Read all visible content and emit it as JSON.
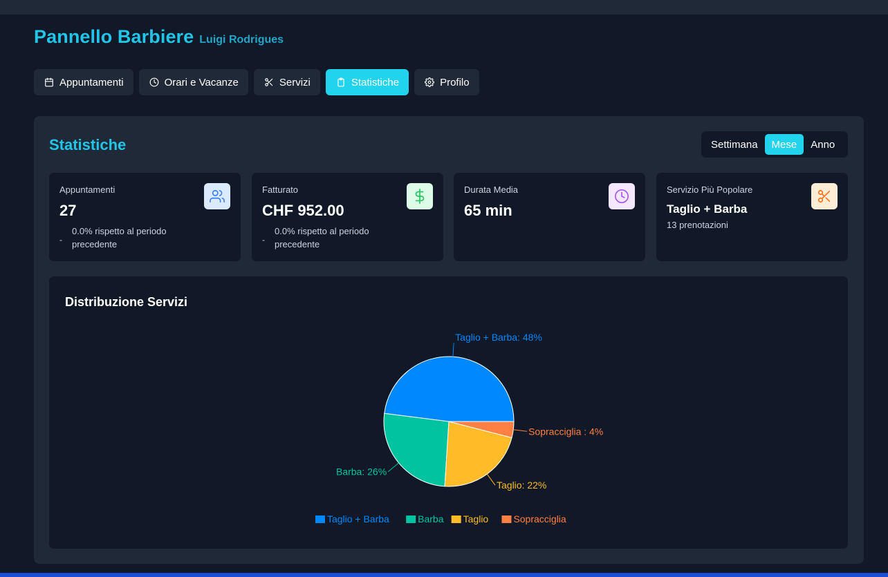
{
  "header": {
    "title": "Pannello Barbiere",
    "user": "Luigi Rodrigues"
  },
  "tabs": [
    {
      "label": "Appuntamenti",
      "icon": "calendar-icon"
    },
    {
      "label": "Orari e Vacanze",
      "icon": "clock-icon"
    },
    {
      "label": "Servizi",
      "icon": "scissors-icon"
    },
    {
      "label": "Statistiche",
      "icon": "clipboard-icon",
      "active": true
    },
    {
      "label": "Profilo",
      "icon": "gear-icon"
    }
  ],
  "stats": {
    "title": "Statistiche",
    "period_options": [
      "Settimana",
      "Mese",
      "Anno"
    ],
    "period_selected": "Mese",
    "cards": {
      "appointments": {
        "label": "Appuntamenti",
        "value": "27",
        "dash": "-",
        "comparison": "0.0% rispetto al periodo precedente",
        "icon": "users-icon"
      },
      "revenue": {
        "label": "Fatturato",
        "value": "CHF 952.00",
        "dash": "-",
        "comparison": "0.0% rispetto al periodo precedente",
        "icon": "dollar-icon"
      },
      "avg_duration": {
        "label": "Durata Media",
        "value": "65 min",
        "icon": "clock-icon"
      },
      "popular": {
        "label": "Servizio Più Popolare",
        "value": "Taglio + Barba",
        "sub": "13 prenotazioni",
        "icon": "scissors-icon"
      }
    }
  },
  "colors": {
    "accent": "#22d3ee",
    "taglio_barba": "#0088fe",
    "barba": "#00c49f",
    "taglio": "#ffbb28",
    "sopracciglia": "#ff8042"
  },
  "chart_data": {
    "type": "pie",
    "title": "Distribuzione Servizi",
    "categories": [
      "Taglio + Barba",
      "Barba",
      "Taglio",
      "Sopracciglia"
    ],
    "values": [
      48,
      26,
      22,
      4
    ],
    "slice_labels": [
      "Taglio + Barba: 48%",
      "Barba: 26%",
      "Taglio: 22%",
      "Sopracciglia : 4%"
    ],
    "colors": [
      "#0088fe",
      "#00c49f",
      "#ffbb28",
      "#ff8042"
    ],
    "legend_position": "bottom-center"
  }
}
